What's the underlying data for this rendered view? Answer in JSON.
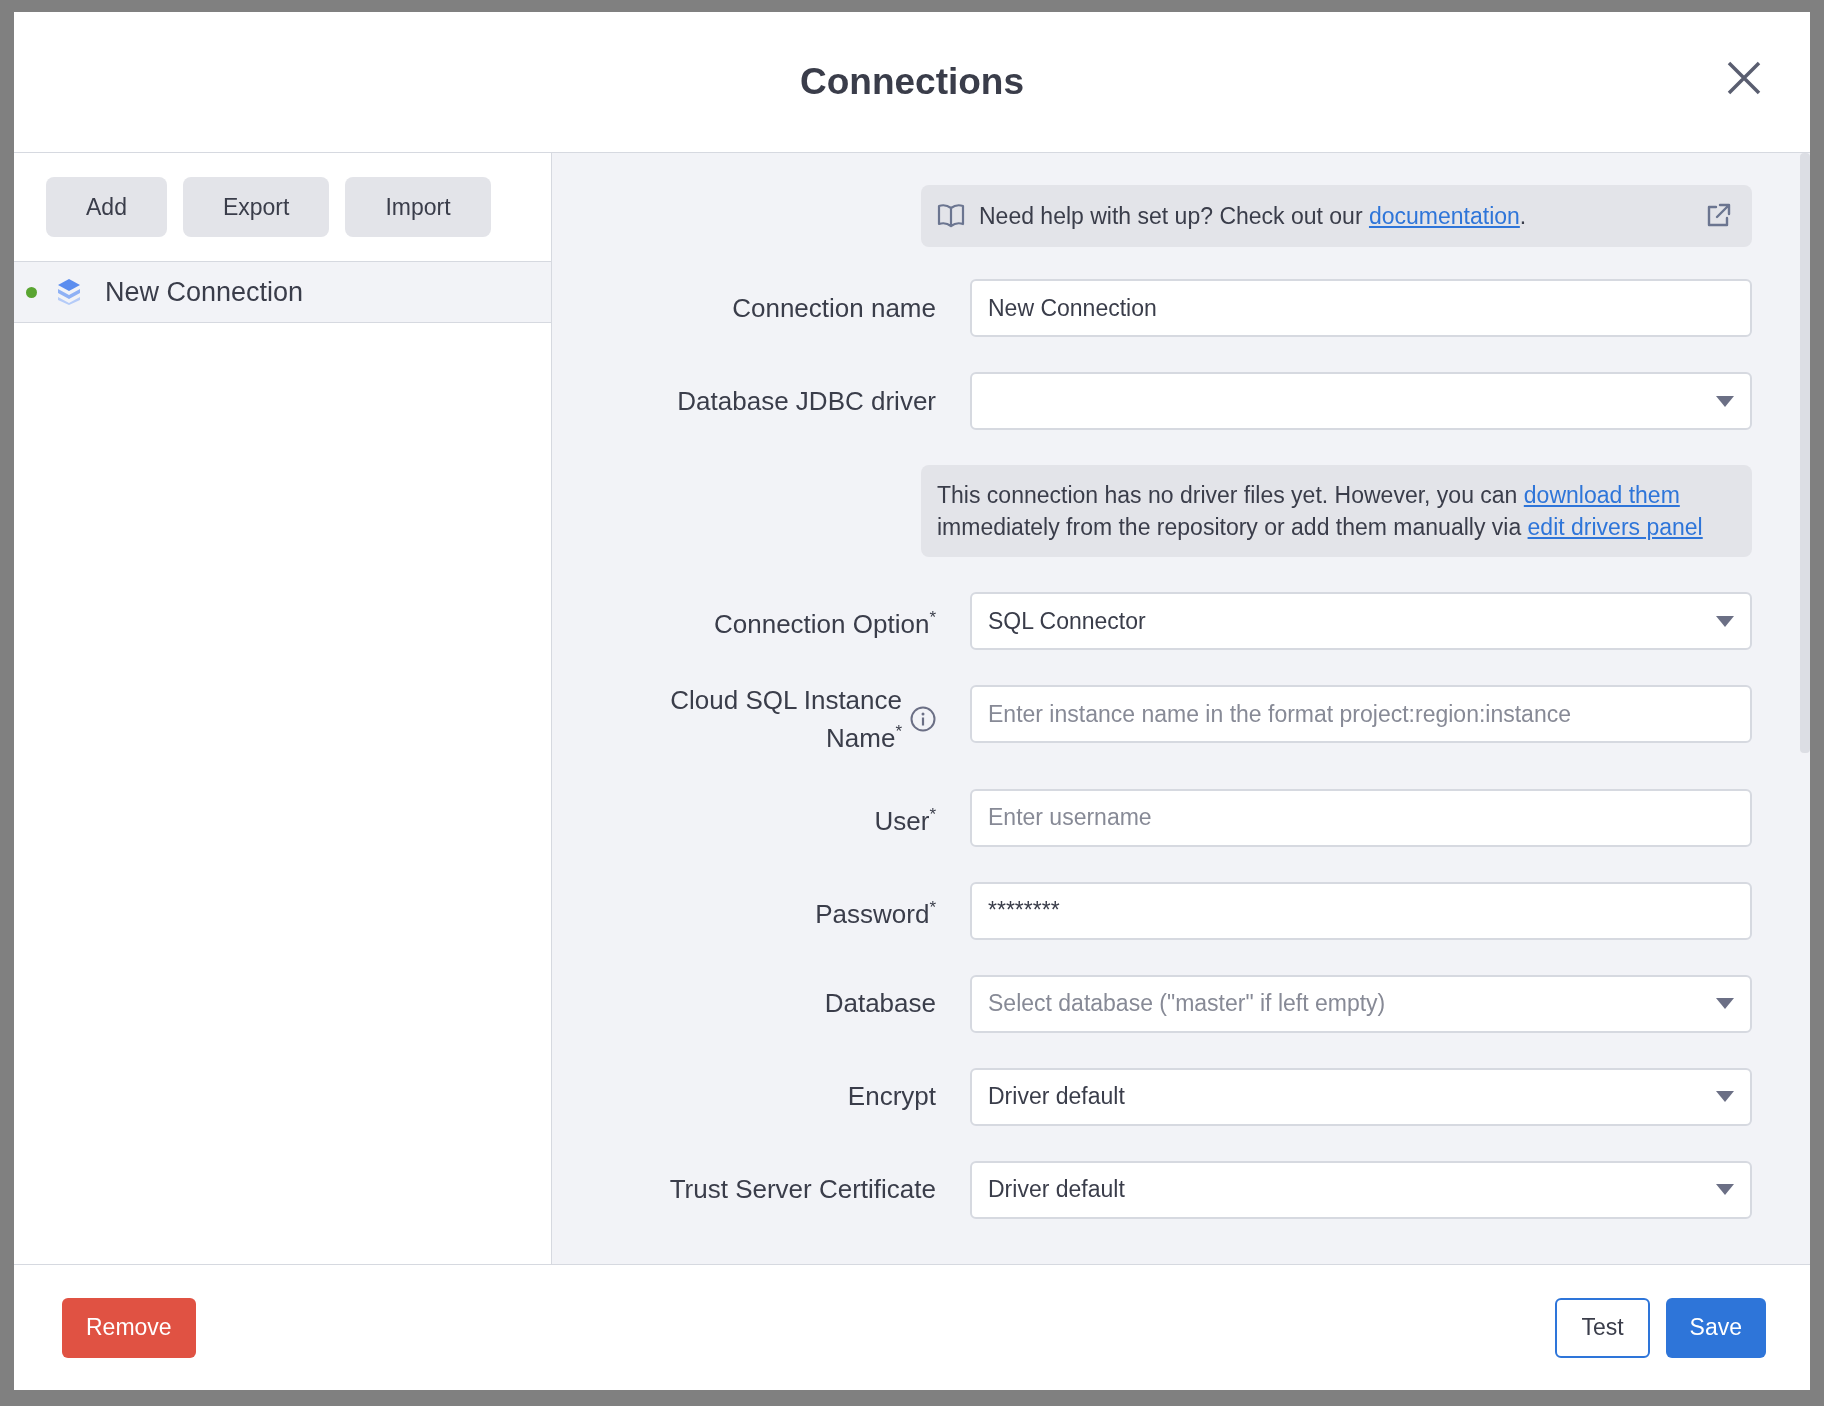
{
  "dialog": {
    "title": "Connections"
  },
  "toolbar": [
    "Add",
    "Export",
    "Import"
  ],
  "connections": [
    {
      "name": "New Connection",
      "color": "#5aa532",
      "selected": true
    }
  ],
  "help": {
    "parts": [
      {
        "kind": "text",
        "text": "Need help with set up? Check out our "
      },
      {
        "kind": "link",
        "text": "documentation"
      },
      {
        "kind": "text",
        "text": "."
      }
    ]
  },
  "form": [
    {
      "kind": "text",
      "label": "Connection name",
      "value": "New Connection"
    },
    {
      "kind": "select",
      "label": "Database JDBC driver"
    },
    {
      "kind": "note",
      "parts": [
        {
          "kind": "text",
          "text": "This connection has no driver files yet. However, you can "
        },
        {
          "kind": "link",
          "text": "download them"
        },
        {
          "kind": "text",
          "text": " immediately from the repository or add them manually via "
        },
        {
          "kind": "link",
          "text": "edit drivers panel"
        }
      ]
    },
    {
      "kind": "select",
      "label": "Connection Option$^{*}$",
      "value": "SQL Connector"
    },
    {
      "kind": "text",
      "label": "Cloud SQL Instance Name$^{*}$",
      "info": true,
      "placeholder": "Enter instance name in the format project:region:instance"
    },
    {
      "kind": "text",
      "label": "User$^{*}$",
      "placeholder": "Enter username"
    },
    {
      "kind": "text",
      "label": "Password$^{*}$",
      "value": "********"
    },
    {
      "kind": "select",
      "label": "Database",
      "placeholder": "Select database (\"master\" if left empty)"
    },
    {
      "kind": "select",
      "label": "Encrypt",
      "value": "Driver default"
    },
    {
      "kind": "select",
      "label": "Trust Server Certificate",
      "value": "Driver default"
    }
  ],
  "footer": {
    "remove": "Remove",
    "test": "Test",
    "save": "Save"
  }
}
